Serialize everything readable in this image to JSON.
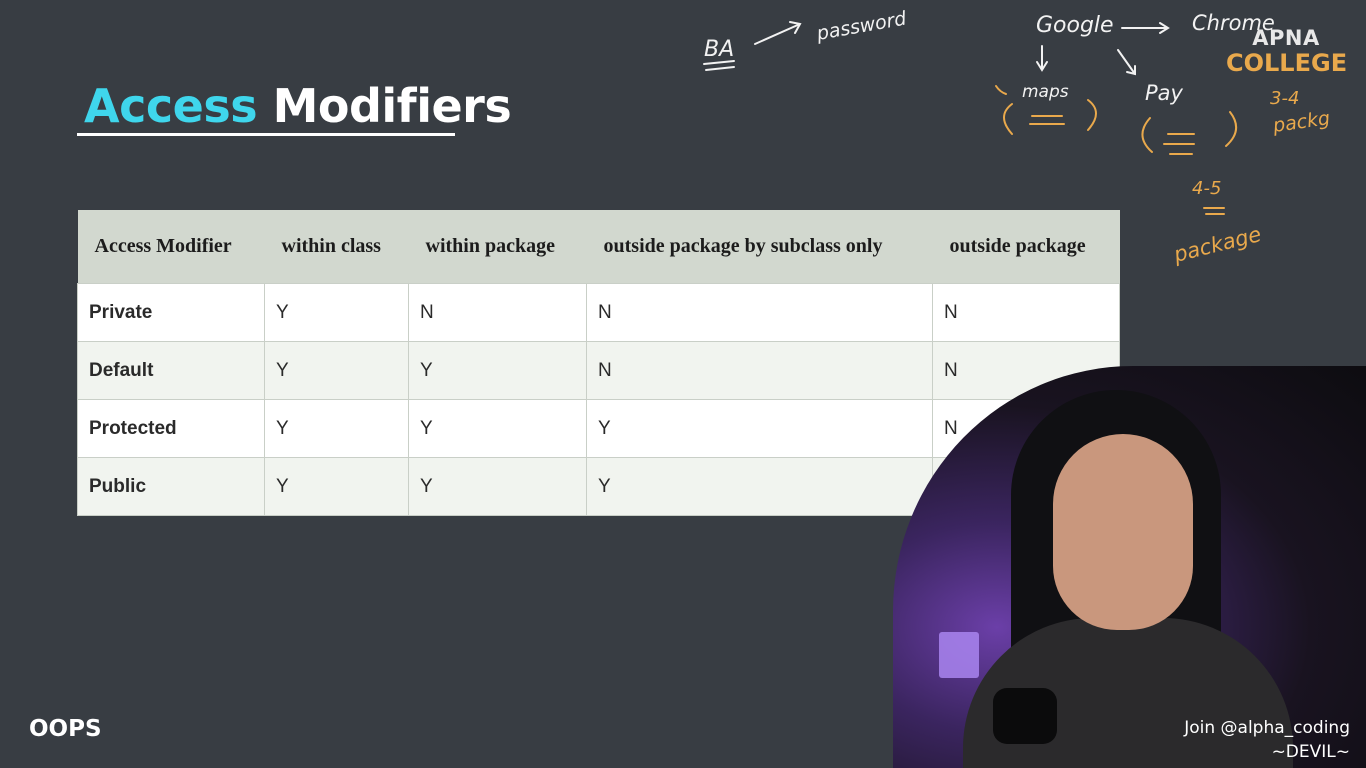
{
  "slide": {
    "title_word1": "Access",
    "title_word2": "Modifiers",
    "section_label": "OOPS"
  },
  "table": {
    "headers": [
      "Access Modifier",
      "within class",
      "within package",
      "outside package by subclass only",
      "outside package"
    ],
    "rows": [
      [
        "Private",
        "Y",
        "N",
        "N",
        "N"
      ],
      [
        "Default",
        "Y",
        "Y",
        "N",
        "N"
      ],
      [
        "Protected",
        "Y",
        "Y",
        "Y",
        "N"
      ],
      [
        "Public",
        "Y",
        "Y",
        "Y",
        ""
      ]
    ]
  },
  "logo": {
    "line1": "APNA",
    "line2": "COLLEGE"
  },
  "annotations": {
    "white": [
      "BA",
      "password",
      "Google",
      "Chrome",
      "maps",
      "Pay"
    ],
    "orange": [
      "3-4",
      "packg",
      "4-5",
      "package"
    ]
  },
  "overlay": {
    "join": "Join @alpha_coding",
    "signature": "~DEVIL~"
  },
  "colors": {
    "background": "#383d43",
    "title_accent": "#3fd6ec",
    "header_row": "#d2d8cf",
    "ink_orange": "#e9a94c"
  }
}
